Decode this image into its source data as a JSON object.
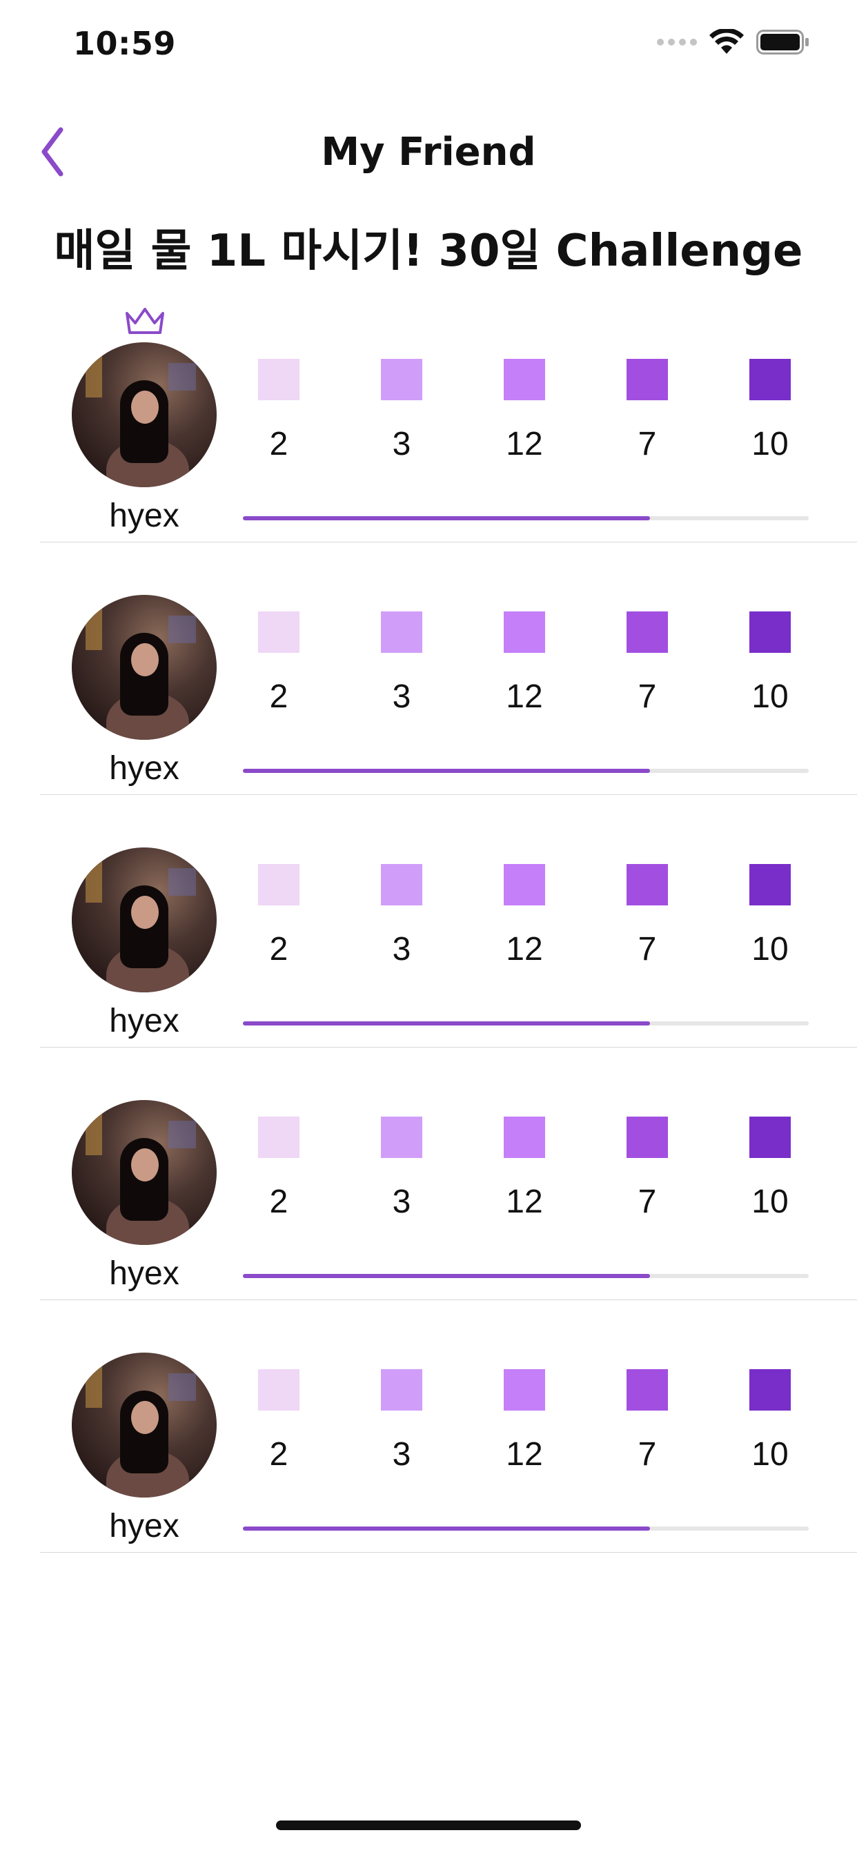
{
  "status_bar": {
    "time": "10:59",
    "icons": [
      "cellular-signal-icon",
      "wifi-icon",
      "battery-icon"
    ]
  },
  "nav": {
    "title": "My Friend",
    "back_icon": "chevron-left-icon"
  },
  "challenge_title": "매일 물 1L 마시기! 30일 Challenge",
  "colors": {
    "accent": "#8a4ac9",
    "level_colors": [
      "#efd7f6",
      "#d09ef9",
      "#c47ff9",
      "#a24fe1",
      "#792ec9"
    ],
    "progress_track": "#e6e6e6"
  },
  "friends": [
    {
      "name": "hyex",
      "has_crown": true,
      "levels": [
        {
          "value": "2"
        },
        {
          "value": "3"
        },
        {
          "value": "12"
        },
        {
          "value": "7"
        },
        {
          "value": "10"
        }
      ],
      "progress": 0.72
    },
    {
      "name": "hyex",
      "has_crown": false,
      "levels": [
        {
          "value": "2"
        },
        {
          "value": "3"
        },
        {
          "value": "12"
        },
        {
          "value": "7"
        },
        {
          "value": "10"
        }
      ],
      "progress": 0.72
    },
    {
      "name": "hyex",
      "has_crown": false,
      "levels": [
        {
          "value": "2"
        },
        {
          "value": "3"
        },
        {
          "value": "12"
        },
        {
          "value": "7"
        },
        {
          "value": "10"
        }
      ],
      "progress": 0.72
    },
    {
      "name": "hyex",
      "has_crown": false,
      "levels": [
        {
          "value": "2"
        },
        {
          "value": "3"
        },
        {
          "value": "12"
        },
        {
          "value": "7"
        },
        {
          "value": "10"
        }
      ],
      "progress": 0.72
    },
    {
      "name": "hyex",
      "has_crown": false,
      "levels": [
        {
          "value": "2"
        },
        {
          "value": "3"
        },
        {
          "value": "12"
        },
        {
          "value": "7"
        },
        {
          "value": "10"
        }
      ],
      "progress": 0.72
    }
  ]
}
